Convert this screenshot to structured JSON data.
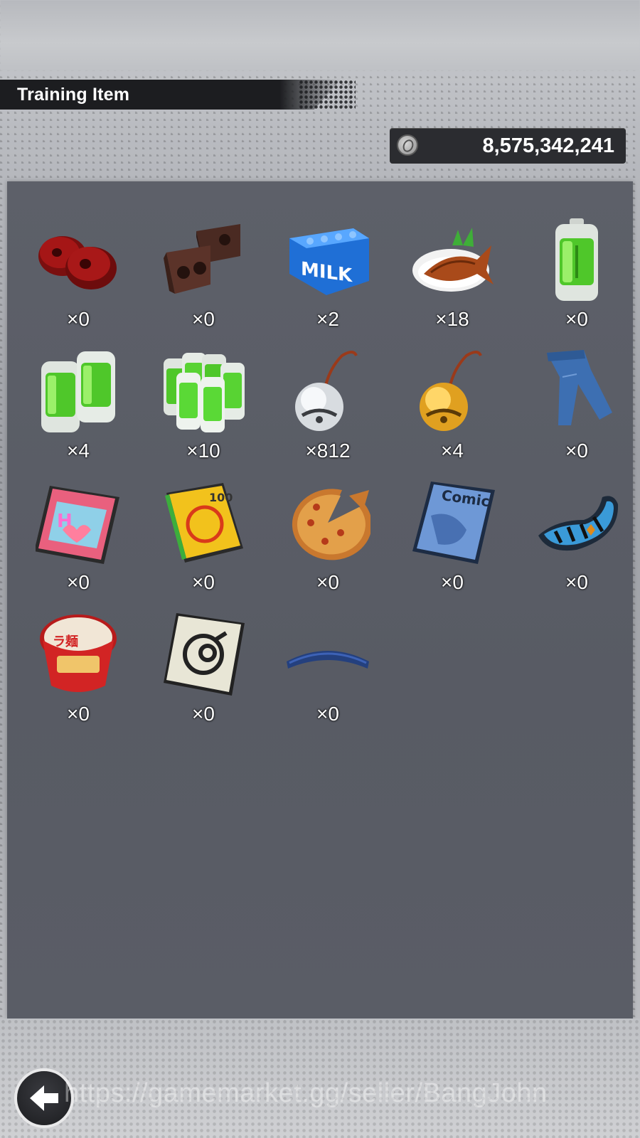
{
  "header": {
    "title": "Training Item"
  },
  "currency": {
    "icon": "zeni-coin-icon",
    "value": "8,575,342,241"
  },
  "items": [
    {
      "icon": "red-weights-icon",
      "count": "×0"
    },
    {
      "icon": "brick-weights-icon",
      "count": "×0"
    },
    {
      "icon": "milk-crate-icon",
      "count": "×2"
    },
    {
      "icon": "grilled-fish-icon",
      "count": "×18"
    },
    {
      "icon": "battery-icon",
      "count": "×0"
    },
    {
      "icon": "battery-pair-icon",
      "count": "×4"
    },
    {
      "icon": "battery-pack-icon",
      "count": "×10"
    },
    {
      "icon": "silver-bell-icon",
      "count": "×812"
    },
    {
      "icon": "gold-bell-icon",
      "count": "×4"
    },
    {
      "icon": "jeans-icon",
      "count": "×0"
    },
    {
      "icon": "pink-magazine-icon",
      "count": "×0"
    },
    {
      "icon": "joke-book-icon",
      "count": "×0"
    },
    {
      "icon": "pizza-icon",
      "count": "×0"
    },
    {
      "icon": "comic-book-icon",
      "count": "×0"
    },
    {
      "icon": "shoe-insole-icon",
      "count": "×0"
    },
    {
      "icon": "ramen-cup-icon",
      "count": "×0"
    },
    {
      "icon": "capsule-card-icon",
      "count": "×0"
    },
    {
      "icon": "blue-headband-icon",
      "count": "×0"
    }
  ],
  "footer": {
    "back_icon": "back-arrow-icon",
    "watermark": "https://gamemarket.gg/seller/BangJohn"
  }
}
